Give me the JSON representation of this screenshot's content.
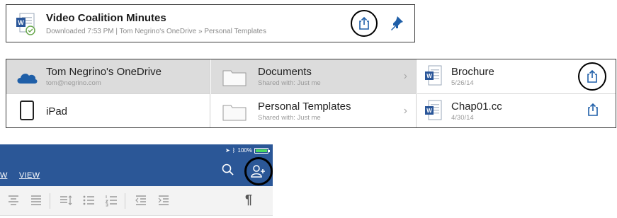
{
  "recent_file": {
    "title": "Video Coalition Minutes",
    "subtitle": "Downloaded 7:53 PM | Tom Negrino's OneDrive » Personal Templates",
    "icon": "word-document-icon",
    "actions": [
      "share-icon",
      "pin-icon"
    ]
  },
  "browser": {
    "locations": [
      {
        "name": "Tom Negrino's OneDrive",
        "sub": "tom@negrino.com",
        "icon": "onedrive-cloud-icon",
        "selected": true
      },
      {
        "name": "iPad",
        "sub": "",
        "icon": "ipad-icon",
        "selected": false
      }
    ],
    "folders": [
      {
        "name": "Documents",
        "sub": "Shared with: Just me",
        "icon": "folder-icon",
        "selected": true
      },
      {
        "name": "Personal Templates",
        "sub": "Shared with: Just me",
        "icon": "folder-icon",
        "selected": false
      }
    ],
    "files": [
      {
        "name": "Brochure",
        "date": "5/26/14",
        "icon": "word-document-icon"
      },
      {
        "name": "Chap01.cc",
        "date": "4/30/14",
        "icon": "word-document-icon"
      }
    ]
  },
  "toolbar": {
    "status": {
      "battery": "100%",
      "icons": [
        "location-icon",
        "bluetooth-icon",
        "battery-icon"
      ]
    },
    "menu_partial": "W",
    "menu_view": "VIEW",
    "formatting_icons": [
      "align-center-icon",
      "align-right-icon",
      "line-spacing-icon",
      "bullet-list-icon",
      "numbered-list-icon",
      "decrease-indent-icon",
      "increase-indent-icon",
      "paragraph-mark-icon"
    ],
    "paragraph_mark": "¶"
  },
  "colors": {
    "accent_blue": "#2b5797",
    "word_blue": "#2a5699",
    "pin_blue": "#1f5fa8",
    "selected_row": "#dcdcdc"
  }
}
